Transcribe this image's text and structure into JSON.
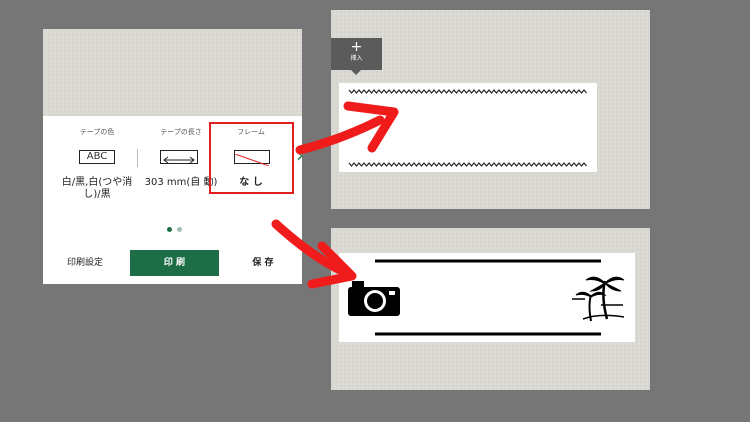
{
  "settings_panel": {
    "tape_color": {
      "label": "テープの色",
      "icon_text": "ABC",
      "value": "白/黒,白(つや消し)/黒"
    },
    "tape_length": {
      "label": "テープの長さ",
      "value": "303 mm(自 動)"
    },
    "frame": {
      "label": "フレーム",
      "value": "な し"
    },
    "pagination": {
      "pages": 2,
      "active": 1
    },
    "buttons": {
      "print_settings": "印刷設定",
      "print": "印 刷",
      "save": "保 存"
    }
  },
  "preview_panel": {
    "insert_button": {
      "label": "挿入"
    }
  },
  "colors": {
    "accent_green": "#1d6e46",
    "highlight_red": "#e02020",
    "arrow_red": "#f01c1c"
  },
  "icons": [
    "length-arrow-icon",
    "no-frame-icon",
    "chevron-right-icon",
    "plus-icon",
    "camera-icon",
    "palm-tree-icon"
  ]
}
